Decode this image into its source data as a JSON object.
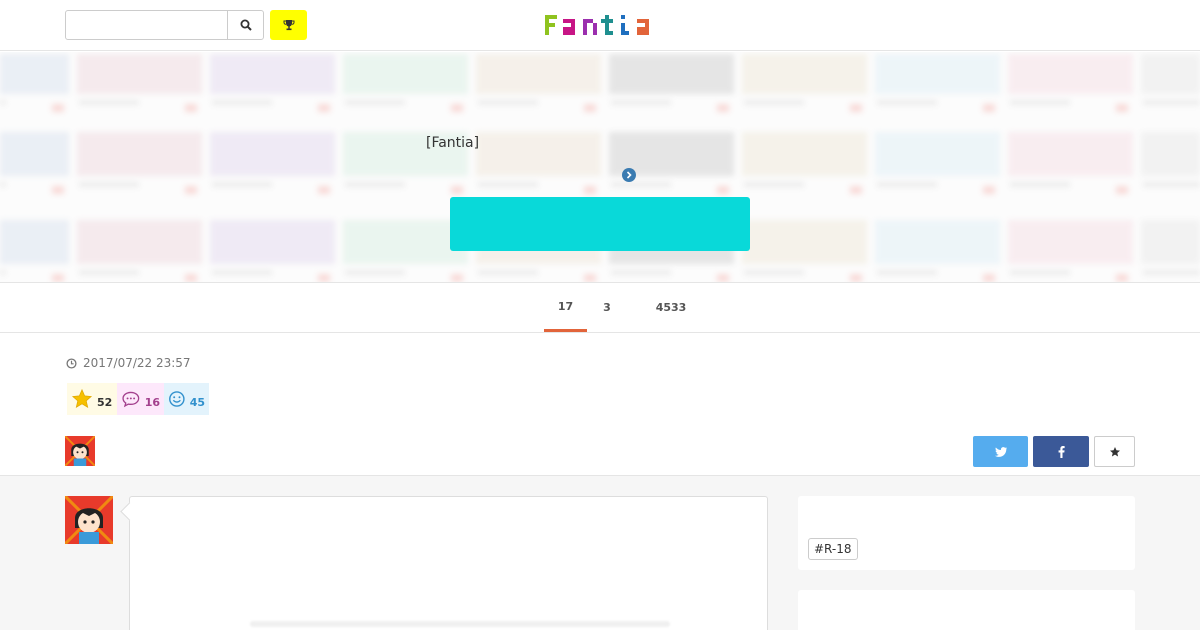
{
  "header": {
    "search_placeholder": "",
    "search_value": "",
    "logo_text": "Fantia",
    "logo_colors": [
      "#8fc31f",
      "#c71585",
      "#9b2fae",
      "#1f8f8f",
      "#1f6fbf",
      "#e2643a"
    ]
  },
  "hero": {
    "label": "[Fantia]",
    "cta_color": "#09d9d9",
    "chevron_icon": "chevron-right-circle-icon"
  },
  "tabs": [
    {
      "count": "17",
      "active": true
    },
    {
      "count": "3",
      "active": false
    },
    {
      "count": "4533",
      "active": false
    }
  ],
  "post": {
    "date": "2017/07/22 23:57",
    "reactions": {
      "star": "52",
      "comment": "16",
      "smile": "45"
    }
  },
  "sidebar": {
    "tag": "#R-18"
  },
  "colors": {
    "accent_tab": "#e2643a",
    "twitter": "#55acee",
    "facebook": "#3b5998",
    "ranking": "#ffff00"
  }
}
